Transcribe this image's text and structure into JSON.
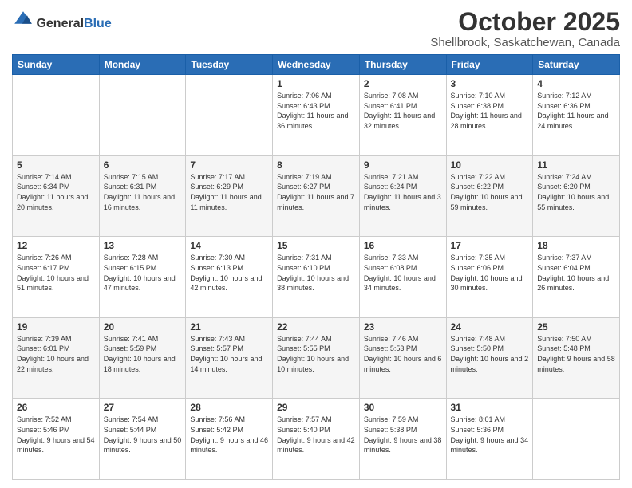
{
  "header": {
    "logo_general": "General",
    "logo_blue": "Blue",
    "title": "October 2025",
    "subtitle": "Shellbrook, Saskatchewan, Canada"
  },
  "days_of_week": [
    "Sunday",
    "Monday",
    "Tuesday",
    "Wednesday",
    "Thursday",
    "Friday",
    "Saturday"
  ],
  "weeks": [
    [
      {
        "day": "",
        "sunrise": "",
        "sunset": "",
        "daylight": ""
      },
      {
        "day": "",
        "sunrise": "",
        "sunset": "",
        "daylight": ""
      },
      {
        "day": "",
        "sunrise": "",
        "sunset": "",
        "daylight": ""
      },
      {
        "day": "1",
        "sunrise": "Sunrise: 7:06 AM",
        "sunset": "Sunset: 6:43 PM",
        "daylight": "Daylight: 11 hours and 36 minutes."
      },
      {
        "day": "2",
        "sunrise": "Sunrise: 7:08 AM",
        "sunset": "Sunset: 6:41 PM",
        "daylight": "Daylight: 11 hours and 32 minutes."
      },
      {
        "day": "3",
        "sunrise": "Sunrise: 7:10 AM",
        "sunset": "Sunset: 6:38 PM",
        "daylight": "Daylight: 11 hours and 28 minutes."
      },
      {
        "day": "4",
        "sunrise": "Sunrise: 7:12 AM",
        "sunset": "Sunset: 6:36 PM",
        "daylight": "Daylight: 11 hours and 24 minutes."
      }
    ],
    [
      {
        "day": "5",
        "sunrise": "Sunrise: 7:14 AM",
        "sunset": "Sunset: 6:34 PM",
        "daylight": "Daylight: 11 hours and 20 minutes."
      },
      {
        "day": "6",
        "sunrise": "Sunrise: 7:15 AM",
        "sunset": "Sunset: 6:31 PM",
        "daylight": "Daylight: 11 hours and 16 minutes."
      },
      {
        "day": "7",
        "sunrise": "Sunrise: 7:17 AM",
        "sunset": "Sunset: 6:29 PM",
        "daylight": "Daylight: 11 hours and 11 minutes."
      },
      {
        "day": "8",
        "sunrise": "Sunrise: 7:19 AM",
        "sunset": "Sunset: 6:27 PM",
        "daylight": "Daylight: 11 hours and 7 minutes."
      },
      {
        "day": "9",
        "sunrise": "Sunrise: 7:21 AM",
        "sunset": "Sunset: 6:24 PM",
        "daylight": "Daylight: 11 hours and 3 minutes."
      },
      {
        "day": "10",
        "sunrise": "Sunrise: 7:22 AM",
        "sunset": "Sunset: 6:22 PM",
        "daylight": "Daylight: 10 hours and 59 minutes."
      },
      {
        "day": "11",
        "sunrise": "Sunrise: 7:24 AM",
        "sunset": "Sunset: 6:20 PM",
        "daylight": "Daylight: 10 hours and 55 minutes."
      }
    ],
    [
      {
        "day": "12",
        "sunrise": "Sunrise: 7:26 AM",
        "sunset": "Sunset: 6:17 PM",
        "daylight": "Daylight: 10 hours and 51 minutes."
      },
      {
        "day": "13",
        "sunrise": "Sunrise: 7:28 AM",
        "sunset": "Sunset: 6:15 PM",
        "daylight": "Daylight: 10 hours and 47 minutes."
      },
      {
        "day": "14",
        "sunrise": "Sunrise: 7:30 AM",
        "sunset": "Sunset: 6:13 PM",
        "daylight": "Daylight: 10 hours and 42 minutes."
      },
      {
        "day": "15",
        "sunrise": "Sunrise: 7:31 AM",
        "sunset": "Sunset: 6:10 PM",
        "daylight": "Daylight: 10 hours and 38 minutes."
      },
      {
        "day": "16",
        "sunrise": "Sunrise: 7:33 AM",
        "sunset": "Sunset: 6:08 PM",
        "daylight": "Daylight: 10 hours and 34 minutes."
      },
      {
        "day": "17",
        "sunrise": "Sunrise: 7:35 AM",
        "sunset": "Sunset: 6:06 PM",
        "daylight": "Daylight: 10 hours and 30 minutes."
      },
      {
        "day": "18",
        "sunrise": "Sunrise: 7:37 AM",
        "sunset": "Sunset: 6:04 PM",
        "daylight": "Daylight: 10 hours and 26 minutes."
      }
    ],
    [
      {
        "day": "19",
        "sunrise": "Sunrise: 7:39 AM",
        "sunset": "Sunset: 6:01 PM",
        "daylight": "Daylight: 10 hours and 22 minutes."
      },
      {
        "day": "20",
        "sunrise": "Sunrise: 7:41 AM",
        "sunset": "Sunset: 5:59 PM",
        "daylight": "Daylight: 10 hours and 18 minutes."
      },
      {
        "day": "21",
        "sunrise": "Sunrise: 7:43 AM",
        "sunset": "Sunset: 5:57 PM",
        "daylight": "Daylight: 10 hours and 14 minutes."
      },
      {
        "day": "22",
        "sunrise": "Sunrise: 7:44 AM",
        "sunset": "Sunset: 5:55 PM",
        "daylight": "Daylight: 10 hours and 10 minutes."
      },
      {
        "day": "23",
        "sunrise": "Sunrise: 7:46 AM",
        "sunset": "Sunset: 5:53 PM",
        "daylight": "Daylight: 10 hours and 6 minutes."
      },
      {
        "day": "24",
        "sunrise": "Sunrise: 7:48 AM",
        "sunset": "Sunset: 5:50 PM",
        "daylight": "Daylight: 10 hours and 2 minutes."
      },
      {
        "day": "25",
        "sunrise": "Sunrise: 7:50 AM",
        "sunset": "Sunset: 5:48 PM",
        "daylight": "Daylight: 9 hours and 58 minutes."
      }
    ],
    [
      {
        "day": "26",
        "sunrise": "Sunrise: 7:52 AM",
        "sunset": "Sunset: 5:46 PM",
        "daylight": "Daylight: 9 hours and 54 minutes."
      },
      {
        "day": "27",
        "sunrise": "Sunrise: 7:54 AM",
        "sunset": "Sunset: 5:44 PM",
        "daylight": "Daylight: 9 hours and 50 minutes."
      },
      {
        "day": "28",
        "sunrise": "Sunrise: 7:56 AM",
        "sunset": "Sunset: 5:42 PM",
        "daylight": "Daylight: 9 hours and 46 minutes."
      },
      {
        "day": "29",
        "sunrise": "Sunrise: 7:57 AM",
        "sunset": "Sunset: 5:40 PM",
        "daylight": "Daylight: 9 hours and 42 minutes."
      },
      {
        "day": "30",
        "sunrise": "Sunrise: 7:59 AM",
        "sunset": "Sunset: 5:38 PM",
        "daylight": "Daylight: 9 hours and 38 minutes."
      },
      {
        "day": "31",
        "sunrise": "Sunrise: 8:01 AM",
        "sunset": "Sunset: 5:36 PM",
        "daylight": "Daylight: 9 hours and 34 minutes."
      },
      {
        "day": "",
        "sunrise": "",
        "sunset": "",
        "daylight": ""
      }
    ]
  ]
}
